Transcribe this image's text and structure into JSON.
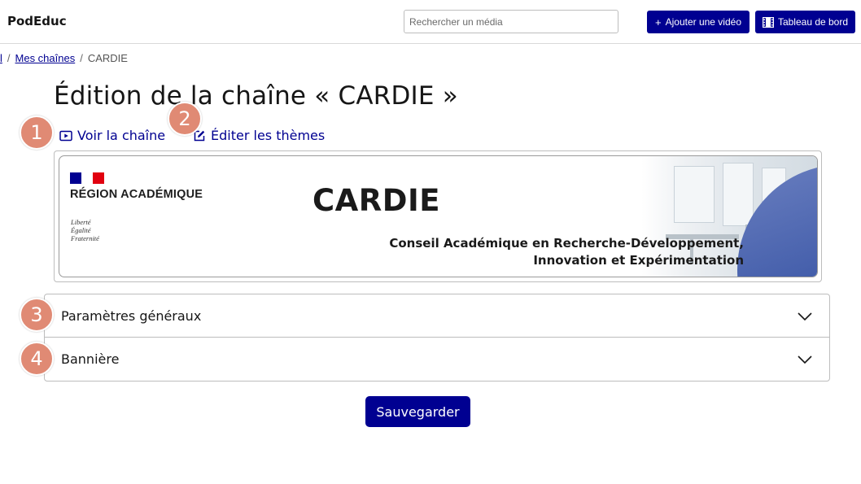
{
  "header": {
    "brand": "PodEduc",
    "search_placeholder": "Rechercher un média",
    "add_video_label": "Ajouter une vidéo",
    "dashboard_label": "Tableau de bord"
  },
  "breadcrumb": {
    "home_label": "l",
    "channels_label": "Mes chaînes",
    "current_label": "CARDIE"
  },
  "page": {
    "title": "Édition de la chaîne « CARDIE »",
    "view_channel_label": "Voir la chaîne",
    "edit_themes_label": "Éditer les thèmes"
  },
  "markers": [
    "1",
    "2",
    "3",
    "4"
  ],
  "banner": {
    "region_label": "RÉGION ACADÉMIQUE",
    "motto": [
      "Liberté",
      "Égalité",
      "Fraternité"
    ],
    "headline": "CARDIE",
    "subtitle_lines": [
      "Conseil Académique en Recherche-Développement,",
      "Innovation et Expérimentation"
    ]
  },
  "sections": [
    {
      "label": "Paramètres généraux"
    },
    {
      "label": "Bannière"
    }
  ],
  "save_label": "Sauvegarder",
  "colors": {
    "primary": "#000091",
    "marker": "#e08a74"
  },
  "icons": {
    "add": "plus-icon",
    "dashboard": "film-icon",
    "view": "video-play-icon",
    "edit": "edit-icon",
    "expand": "chevron-down-icon"
  }
}
